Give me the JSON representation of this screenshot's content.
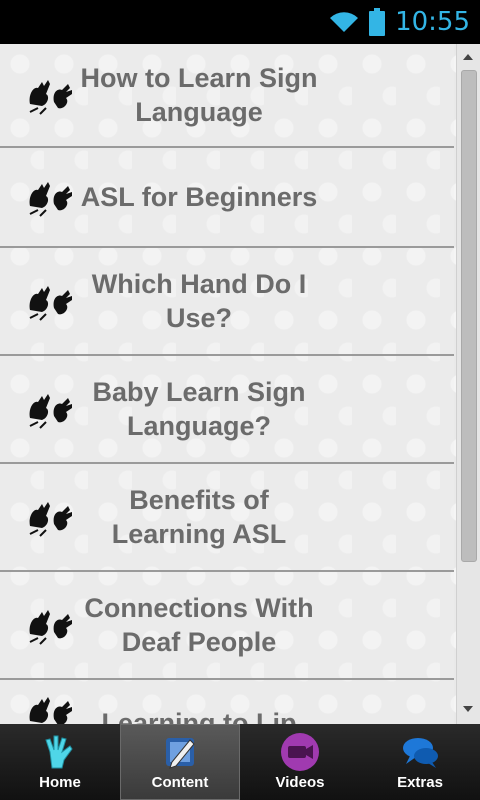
{
  "status_bar": {
    "time": "10:55"
  },
  "list": {
    "items": [
      {
        "label_lines": [
          "How to Learn Sign",
          "Language"
        ]
      },
      {
        "label_lines": [
          "ASL for Beginners"
        ]
      },
      {
        "label_lines": [
          "Which Hand Do I",
          "Use?"
        ]
      },
      {
        "label_lines": [
          "Baby Learn Sign",
          "Language?"
        ]
      },
      {
        "label_lines": [
          "Benefits of",
          "Learning ASL"
        ]
      },
      {
        "label_lines": [
          "Connections With",
          "Deaf People"
        ]
      },
      {
        "label_lines": [
          "Learning to Lip"
        ]
      }
    ]
  },
  "tabs": [
    {
      "label": "Home",
      "icon": "hand-sign-icon"
    },
    {
      "label": "Content",
      "icon": "pencil-note-icon"
    },
    {
      "label": "Videos",
      "icon": "video-camera-icon"
    },
    {
      "label": "Extras",
      "icon": "speech-bubbles-icon"
    }
  ],
  "colors": {
    "accent": "#33b5e5",
    "text": "#6b6b6b",
    "divider": "#9a9a9a"
  }
}
